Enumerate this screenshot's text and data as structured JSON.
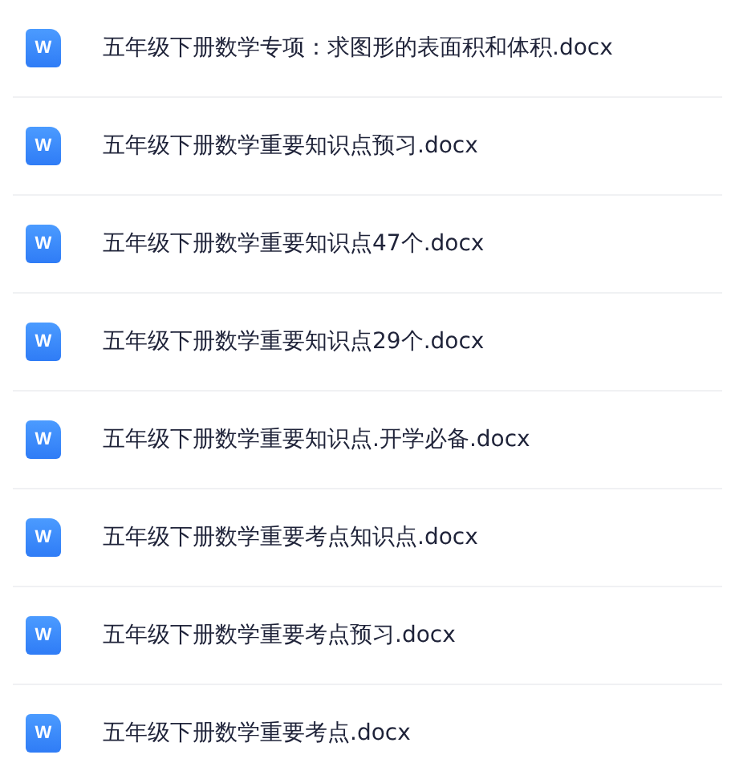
{
  "files": [
    {
      "icon_letter": "W",
      "name": "五年级下册数学专项：求图形的表面积和体积.docx"
    },
    {
      "icon_letter": "W",
      "name": "五年级下册数学重要知识点预习.docx"
    },
    {
      "icon_letter": "W",
      "name": "五年级下册数学重要知识点47个.docx"
    },
    {
      "icon_letter": "W",
      "name": "五年级下册数学重要知识点29个.docx"
    },
    {
      "icon_letter": "W",
      "name": "五年级下册数学重要知识点.开学必备.docx"
    },
    {
      "icon_letter": "W",
      "name": "五年级下册数学重要考点知识点.docx"
    },
    {
      "icon_letter": "W",
      "name": "五年级下册数学重要考点预习.docx"
    },
    {
      "icon_letter": "W",
      "name": "五年级下册数学重要考点.docx"
    }
  ]
}
